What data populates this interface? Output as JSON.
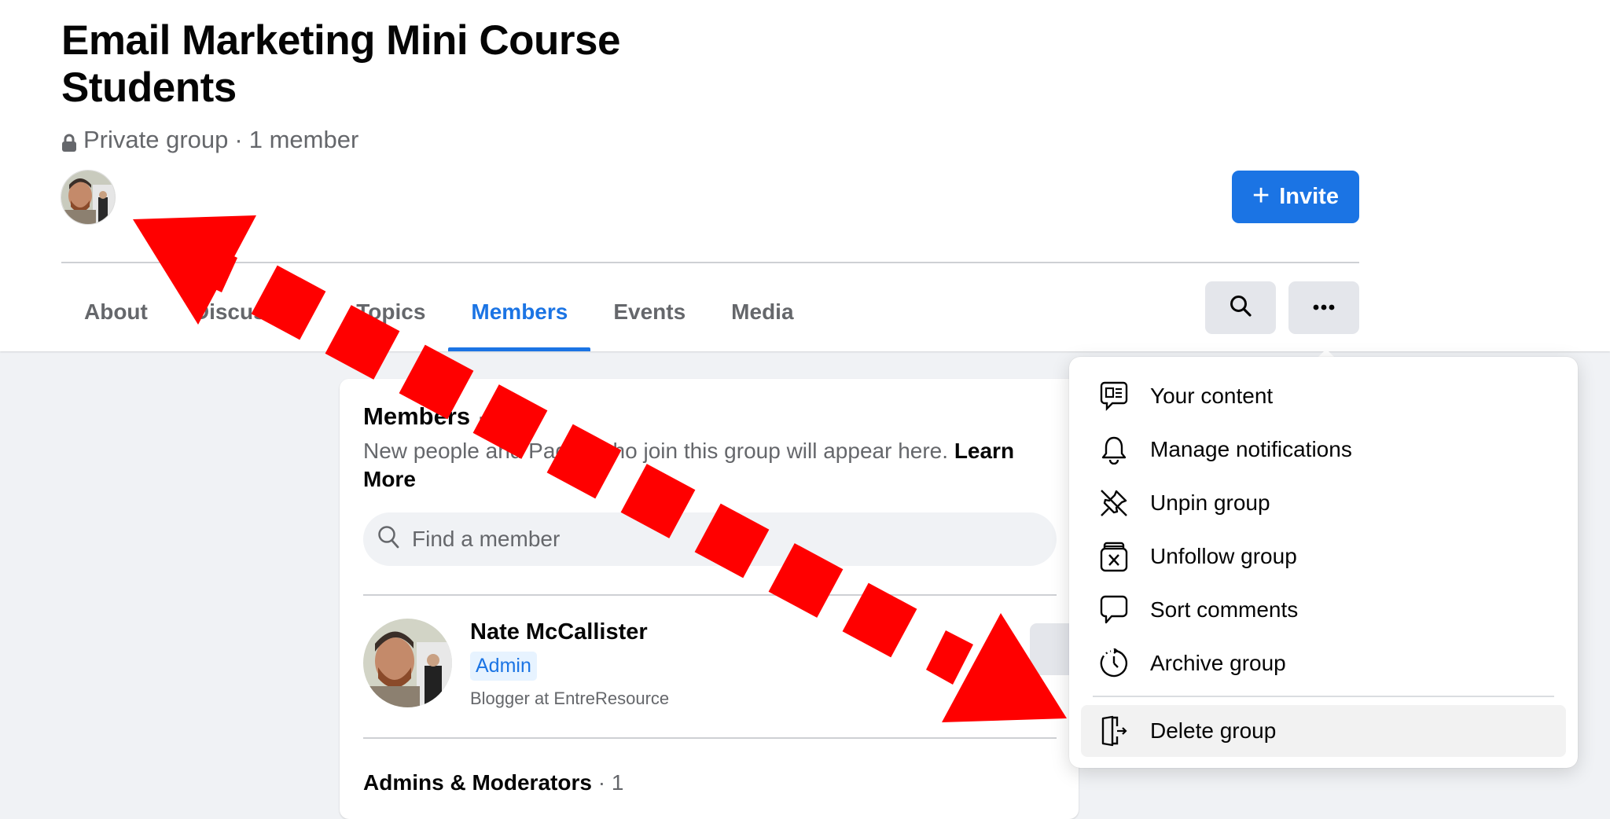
{
  "group": {
    "title": "Email Marketing Mini Course Students",
    "privacy": "Private group",
    "separator": "·",
    "member_count": "1 member",
    "invite_label": "Invite"
  },
  "tabs": [
    {
      "label": "About",
      "active": false
    },
    {
      "label": "Discussion",
      "active": false
    },
    {
      "label": "Topics",
      "active": false
    },
    {
      "label": "Members",
      "active": true
    },
    {
      "label": "Events",
      "active": false
    },
    {
      "label": "Media",
      "active": false
    }
  ],
  "toolbar": {
    "search_icon": "search-icon",
    "more_icon": "more-horizontal-icon"
  },
  "members_card": {
    "title": "Members",
    "title_suffix": "· 1",
    "description": "New people and Pages who join this group will appear here.",
    "learn_more": "Learn More",
    "search_placeholder": "Find a member",
    "member": {
      "name": "Nate McCallister",
      "badge": "Admin",
      "subtitle": "Blogger at EntreResource"
    },
    "admins_section": "Admins & Moderators",
    "admins_count": "· 1"
  },
  "menu": {
    "items": [
      {
        "label": "Your content",
        "icon": "content-icon"
      },
      {
        "label": "Manage notifications",
        "icon": "bell-icon"
      },
      {
        "label": "Unpin group",
        "icon": "unpin-icon"
      },
      {
        "label": "Unfollow group",
        "icon": "unfollow-icon"
      },
      {
        "label": "Sort comments",
        "icon": "comment-icon"
      },
      {
        "label": "Archive group",
        "icon": "archive-icon"
      },
      {
        "label": "Delete group",
        "icon": "exit-door-icon",
        "highlighted": true
      }
    ]
  },
  "colors": {
    "accent": "#1B74E4",
    "annotation": "#FF0000",
    "background": "#F0F2F5"
  }
}
